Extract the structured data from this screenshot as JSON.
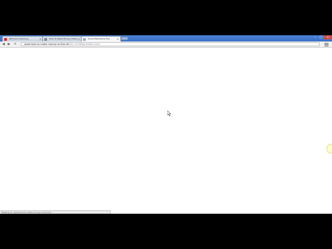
{
  "browser": {
    "tabs": [
      {
        "label": "[ZH] Live Sendung",
        "favicon_color": "#d22"
      },
      {
        "label": "How To Make Money Online",
        "favicon_color": "#888"
      },
      {
        "label": "Social Marketing Tips",
        "favicon_color": "#9ab",
        "active": true
      }
    ],
    "address": {
      "host": "www.how-to-make-money-online.de",
      "path": "/?p=1234&preview=true"
    },
    "status_text": "Waiting for www.how-to-make-money-online.de..."
  },
  "icons": {
    "back": "back-arrow-icon",
    "forward": "forward-arrow-icon",
    "reload": "reload-icon",
    "menu": "menu-icon",
    "cursor": "mouse-cursor-icon"
  },
  "colors": {
    "tabstrip": "#3a6fc4",
    "page": "#ffffff",
    "frame": "#000000"
  }
}
